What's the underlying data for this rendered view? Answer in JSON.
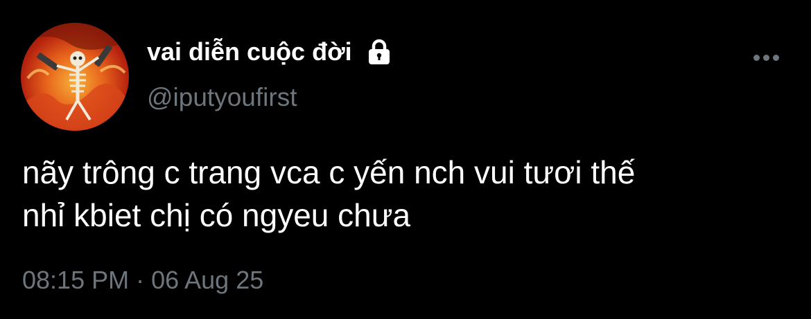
{
  "tweet": {
    "author": {
      "display_name": "vai diễn cuộc đời",
      "handle": "@iputyoufirst",
      "protected_icon": "lock-icon",
      "avatar_icon": "skeleton-with-guns-avatar"
    },
    "text_lines": [
      "nãy trông c trang vca c yến nch vui tươi thế",
      "nhỉ kbiet chị có ngyeu chưa"
    ],
    "timestamp": "08:15 PM · 06 Aug 25",
    "menu_icon": "more-options-icon"
  },
  "colors": {
    "background": "#000000",
    "primary_text": "#ffffff",
    "secondary_text": "#6e767d"
  }
}
